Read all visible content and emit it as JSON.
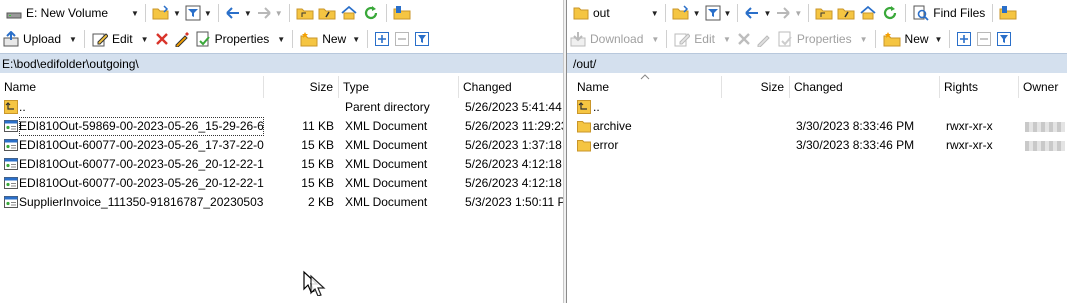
{
  "left": {
    "drive": "E: New Volume",
    "toolbar2": {
      "upload": "Upload",
      "edit": "Edit",
      "properties": "Properties",
      "new": "New"
    },
    "path": "E:\\bod\\edifolder\\outgoing\\",
    "columns": {
      "name": "Name",
      "size": "Size",
      "type": "Type",
      "changed": "Changed"
    },
    "rows": [
      {
        "name": "..",
        "size": "",
        "type": "Parent directory",
        "changed": "5/26/2023 5:41:44 I",
        "kind": "up"
      },
      {
        "name": "EDI810Out-59869-00-2023-05-26_15-29-26-6...",
        "size": "11 KB",
        "type": "XML Document",
        "changed": "5/26/2023 11:29:23",
        "kind": "xml"
      },
      {
        "name": "EDI810Out-60077-00-2023-05-26_17-37-22-0...",
        "size": "15 KB",
        "type": "XML Document",
        "changed": "5/26/2023 1:37:18 I",
        "kind": "xml"
      },
      {
        "name": "EDI810Out-60077-00-2023-05-26_20-12-22-1...",
        "size": "15 KB",
        "type": "XML Document",
        "changed": "5/26/2023 4:12:18 I",
        "kind": "xml"
      },
      {
        "name": "EDI810Out-60077-00-2023-05-26_20-12-22-1...",
        "size": "15 KB",
        "type": "XML Document",
        "changed": "5/26/2023 4:12:18 I",
        "kind": "xml"
      },
      {
        "name": "SupplierInvoice_111350-91816787_202305031...",
        "size": "2 KB",
        "type": "XML Document",
        "changed": "5/3/2023 1:50:11 P",
        "kind": "xml"
      }
    ]
  },
  "right": {
    "folder": "out",
    "find_files": "Find Files",
    "toolbar2": {
      "download": "Download",
      "edit": "Edit",
      "properties": "Properties",
      "new": "New"
    },
    "path": "/out/",
    "columns": {
      "name": "Name",
      "size": "Size",
      "changed": "Changed",
      "rights": "Rights",
      "owner": "Owner"
    },
    "rows": [
      {
        "name": "..",
        "size": "",
        "changed": "",
        "rights": "",
        "kind": "up"
      },
      {
        "name": "archive",
        "size": "",
        "changed": "3/30/2023 8:33:46 PM",
        "rights": "rwxr-xr-x",
        "kind": "folder"
      },
      {
        "name": "error",
        "size": "",
        "changed": "3/30/2023 8:33:46 PM",
        "rights": "rwxr-xr-x",
        "kind": "folder"
      }
    ]
  },
  "colors": {
    "path_bar": "#d4e0ee",
    "folder": "#f5c542",
    "accent_blue": "#2a6fc9",
    "green": "#3aa83a",
    "red": "#d9342b"
  }
}
